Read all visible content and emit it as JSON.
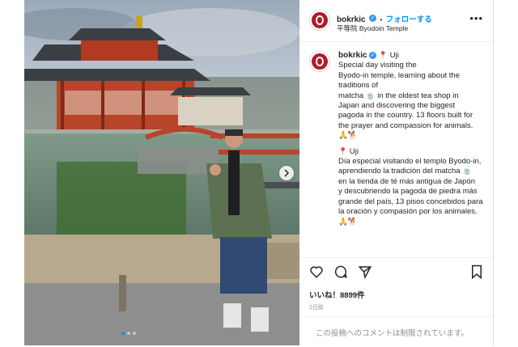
{
  "post": {
    "username": "bokrkic",
    "follow_label": "フォローする",
    "separator": "•",
    "location": "平等院 Byodoin Temple",
    "more_icon": "•••",
    "caption_line": "Uji",
    "caption_en": "Special day visiting the\nByodo-in temple, learning about the\ntraditions of\nmatcha 🍵 in the oldest tea shop in\nJapan and discovering the biggest\npagoda in the country. 13 floors built for\nthe prayer and compassion for animals.\n🙏🐕",
    "caption_es_title": "Uji",
    "caption_es": "Día especial visitando el templo Byodo-in,\naprendiendo la tradición del matcha 🍵\nen la tienda de té más antigua de Japón\ny descubriendo la pagoda de piedra más\ngrande del país, 13 pisos concebidos para\nla oración y compasión por los animales.\n🙏🐕",
    "likes_label": "いいね！8899件",
    "time_label": "2日前",
    "comments_disabled": "この投稿へのコメントは制限されています。"
  },
  "colors": {
    "accent": "#0095f6",
    "verified": "#3897f0",
    "avatar": "#b11a2b",
    "muted": "#8e8e8e"
  },
  "icons": [
    "verified-badge-icon",
    "pin-icon",
    "more-options-icon",
    "heart-icon",
    "comment-icon",
    "share-icon",
    "bookmark-icon",
    "next-arrow-icon"
  ],
  "carousel": {
    "total": 3,
    "active": 1
  }
}
